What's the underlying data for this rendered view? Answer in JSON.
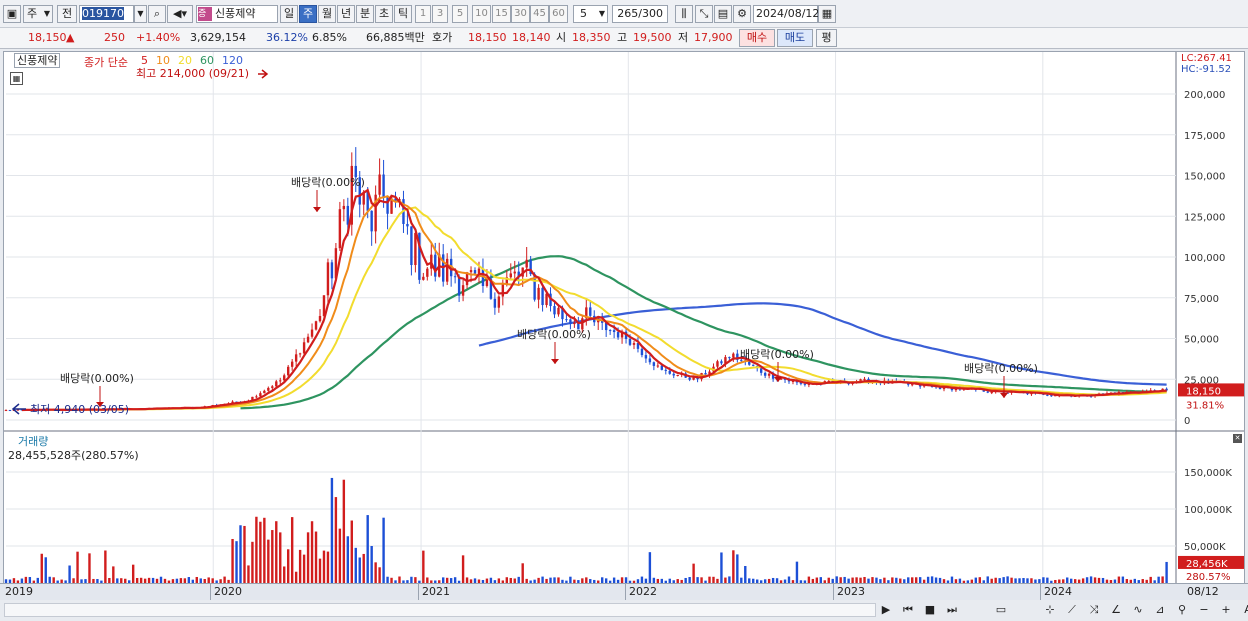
{
  "toolbar": {
    "market": "주",
    "jeon": "전",
    "code": "019170",
    "name": "신풍제약",
    "periods": [
      "일",
      "주",
      "월",
      "년",
      "분",
      "초",
      "틱"
    ],
    "selected_period": "주",
    "ticks": [
      "1",
      "3",
      "5",
      "10",
      "15",
      "30",
      "45",
      "60"
    ],
    "count": "5",
    "view": "265/300",
    "date": "2024/08/12"
  },
  "quote": {
    "price": "18,150",
    "change": "250",
    "pct": "+1.40%",
    "volume": "3,629,154",
    "ratio1": "36.12%",
    "ratio2": "6.85%",
    "amount": "66,885백만",
    "hoga_label": "호가",
    "hoga1": "18,150",
    "hoga2": "18,140",
    "open_label": "시",
    "open": "18,350",
    "high_label": "고",
    "high": "19,500",
    "low_label": "저",
    "low": "17,900",
    "buy": "매수",
    "sell": "매도",
    "eval": "평"
  },
  "price_panel": {
    "name": "신풍제약",
    "ma_label": "종가 단순",
    "ma_periods": [
      "5",
      "10",
      "20",
      "60",
      "120"
    ],
    "ma_colors": [
      "#d11d1d",
      "#f08c1a",
      "#f2dc2e",
      "#2e9460",
      "#3a5fd6"
    ],
    "max_label": "최고 214,000 (09/21)",
    "min_label": "최저 4,940 (03/05)",
    "lc": "LC:267.41",
    "hc": "HC:-91.52",
    "last_price": "18,150",
    "pct_label": "31.81%",
    "dividends": [
      "배당락(0.00%)",
      "배당락(0.00%)",
      "배당락(0.00%)",
      "배당락(0.00%)",
      "배당락(0.00%)"
    ]
  },
  "volume_panel": {
    "title": "거래량",
    "current": "28,455,528주(280.57%)",
    "last_label": "28,456K",
    "pct_label": "280.57%"
  },
  "x_axis": {
    "labels": [
      "2019",
      "2020",
      "2021",
      "2022",
      "2023",
      "2024"
    ],
    "end_label": "08/12"
  },
  "chart_data": {
    "type": "candlestick",
    "price_axis_ticks": [
      0,
      25000,
      50000,
      75000,
      100000,
      125000,
      150000,
      175000,
      200000
    ],
    "price_tick_labels": [
      "0",
      "25,000",
      "50,000",
      "75,000",
      "100,000",
      "125,000",
      "150,000",
      "175,000",
      "200,000"
    ],
    "volume_axis_ticks": [
      50000,
      100000,
      150000
    ],
    "volume_tick_labels": [
      "50,000K",
      "100,000K",
      "150,000K"
    ],
    "close_series_approx": {
      "dates": [
        "2019-01",
        "2019-07",
        "2019-12",
        "2020-03",
        "2020-05",
        "2020-07",
        "2020-08",
        "2020-09",
        "2020-10",
        "2020-11",
        "2021-01",
        "2021-03",
        "2021-05",
        "2021-07",
        "2021-09",
        "2021-11",
        "2022-01",
        "2022-03",
        "2022-05",
        "2022-07",
        "2022-09",
        "2022-11",
        "2023-03",
        "2023-07",
        "2023-11",
        "2024-03",
        "2024-08"
      ],
      "values": [
        6000,
        6500,
        7500,
        12000,
        25000,
        60000,
        100000,
        150000,
        120000,
        140000,
        95000,
        90000,
        78000,
        90000,
        65000,
        60000,
        50000,
        30000,
        25000,
        40000,
        28000,
        22000,
        24000,
        20000,
        17000,
        15000,
        18150
      ]
    },
    "volume_highlights_k": {
      "max": 185000,
      "current": 28456
    }
  }
}
